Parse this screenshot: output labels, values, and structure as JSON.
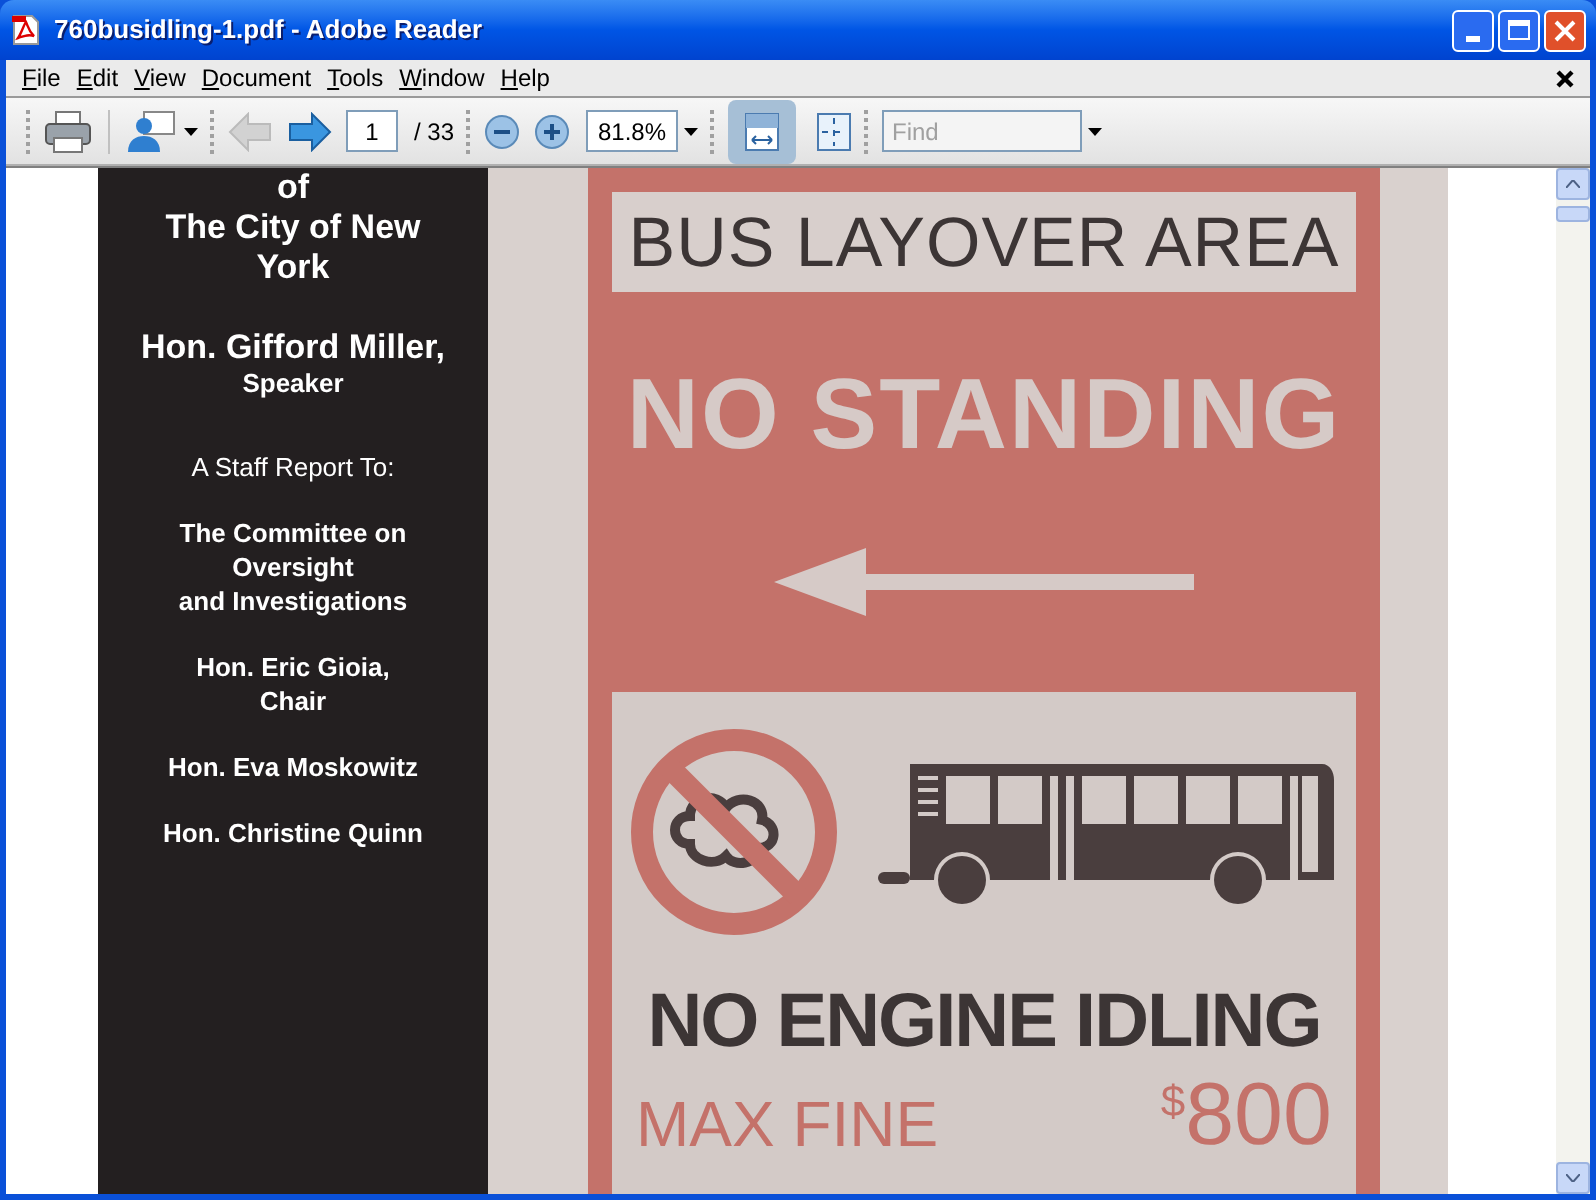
{
  "window": {
    "title": "760busidling-1.pdf - Adobe Reader"
  },
  "menu": [
    {
      "label": "File"
    },
    {
      "label": "Edit"
    },
    {
      "label": "View"
    },
    {
      "label": "Document"
    },
    {
      "label": "Tools"
    },
    {
      "label": "Window"
    },
    {
      "label": "Help"
    }
  ],
  "toolbar": {
    "page_number": "1",
    "page_count": "/ 33",
    "zoom": "81.8%",
    "find_placeholder": "Find",
    "previous_disabled": true,
    "fit_width_selected": true
  },
  "document": {
    "cover_text": [
      {
        "kind": "heading",
        "lines": [
          "of",
          "The City of New",
          "York"
        ]
      },
      {
        "kind": "heading_gap",
        "lines": [
          "Hon. Gifford Miller,"
        ]
      },
      {
        "kind": "role",
        "lines": [
          "Speaker"
        ]
      },
      {
        "kind": "intro",
        "lines": [
          "A Staff Report To:"
        ]
      },
      {
        "kind": "member",
        "lines": [
          "The Committee on",
          "Oversight",
          "and Investigations"
        ]
      },
      {
        "kind": "member",
        "lines": [
          "Hon. Eric Gioia,",
          "Chair"
        ]
      },
      {
        "kind": "member",
        "lines": [
          "Hon. Eva Moskowitz"
        ]
      },
      {
        "kind": "member",
        "lines": [
          "Hon. Christine Quinn"
        ]
      }
    ],
    "sign": {
      "top_label": "BUS LAYOVER AREA",
      "rule": "NO STANDING",
      "warning": "NO ENGINE IDLING",
      "fine_label": "MAX FINE",
      "currency": "$",
      "fine_amount": "800"
    }
  }
}
